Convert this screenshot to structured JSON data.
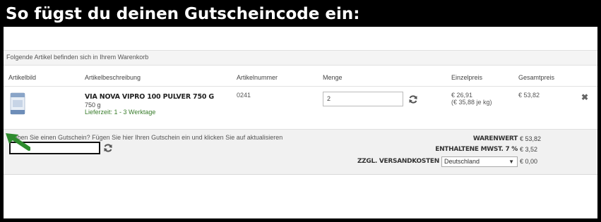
{
  "banner": {
    "title": "So fügst du deinen Gutscheincode ein:"
  },
  "cart": {
    "header_text": "Folgende Artikel befinden sich in Ihrem Warenkorb",
    "columns": [
      "Artikelbild",
      "Artikelbeschreibung",
      "Artikelnummer",
      "Menge",
      "Einzelpreis",
      "Gesamtpreis"
    ],
    "item": {
      "name": "VIA NOVA VIPRO 100 PULVER 750 G",
      "weight": "750 g",
      "delivery": "Lieferzeit: 1 - 3 Werktage",
      "article_number": "0241",
      "quantity": "2",
      "unit_price": "€ 26,91",
      "unit_price_per_kg": "(€ 35,88 je kg)",
      "total_price": "€ 53,82",
      "remove_icon": "close-icon"
    }
  },
  "footer": {
    "voucher_hint": "Haben Sie einen Gutschein? Fügen Sie hier Ihren Gutschein ein und klicken Sie auf aktualisieren",
    "voucher_value": "",
    "summary": {
      "goods_value_label": "WARENWERT",
      "goods_value": "€ 53,82",
      "vat_label": "ENTHALTENE MWST. 7 %",
      "vat_value": "€ 3,52",
      "shipping_label": "ZZGL. VERSANDKOSTEN",
      "shipping_country": "Deutschland",
      "shipping_value": "€ 0,00"
    }
  },
  "colors": {
    "arrow": "#2e8b2e",
    "delivery_text": "#3a7d2c",
    "banner_bg": "#000000"
  }
}
